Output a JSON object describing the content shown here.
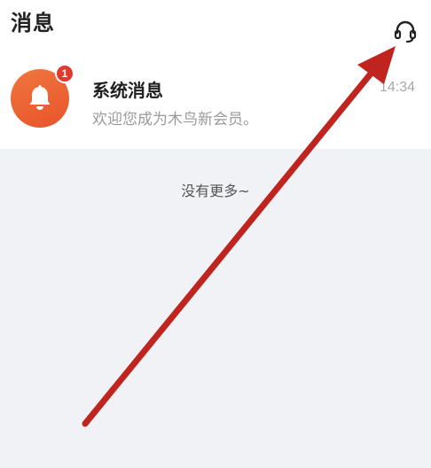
{
  "header": {
    "title": "消息",
    "customer_service_icon": "headset-icon"
  },
  "messages": [
    {
      "icon": "bell-icon",
      "avatar_color": "#ef6a35",
      "badge_count": "1",
      "title": "系统消息",
      "preview": "欢迎您成为木鸟新会员。",
      "time": "14:34"
    }
  ],
  "list_footer": {
    "text": "没有更多~"
  },
  "annotation": {
    "arrow_color": "#c0241f"
  }
}
